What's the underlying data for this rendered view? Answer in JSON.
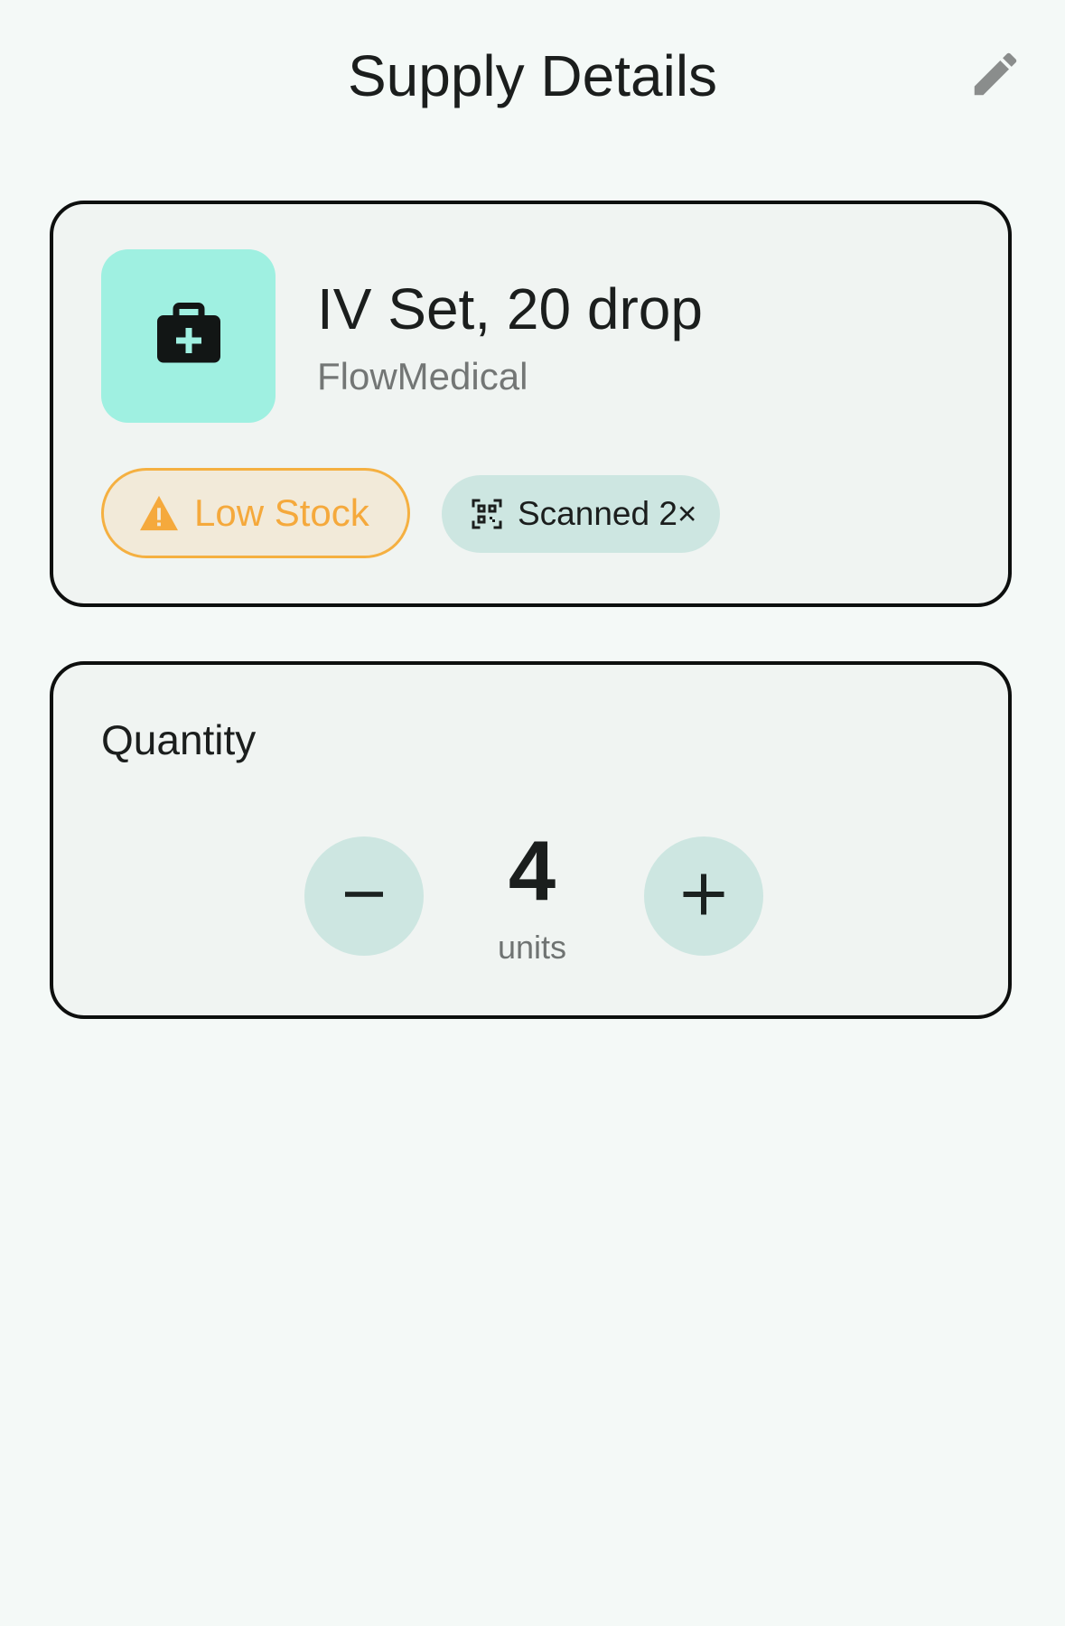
{
  "header": {
    "title": "Supply Details",
    "edit_icon": "pencil-icon"
  },
  "item": {
    "name": "IV Set, 20 drop",
    "brand": "FlowMedical",
    "icon": "medical-bag-icon",
    "icon_tile_color": "#9ff0e1",
    "chips": {
      "low_stock": {
        "label": "Low Stock",
        "icon": "warning-icon",
        "color": "#f5a93c"
      },
      "scanned": {
        "label": "Scanned 2×",
        "icon": "qr-code-icon"
      }
    }
  },
  "quantity": {
    "label": "Quantity",
    "value": "4",
    "unit": "units",
    "decrement_icon": "minus-icon",
    "increment_icon": "plus-icon"
  },
  "colors": {
    "background": "#f4f9f7",
    "card": "#f0f4f2",
    "accent_soft": "#cde6e1"
  }
}
